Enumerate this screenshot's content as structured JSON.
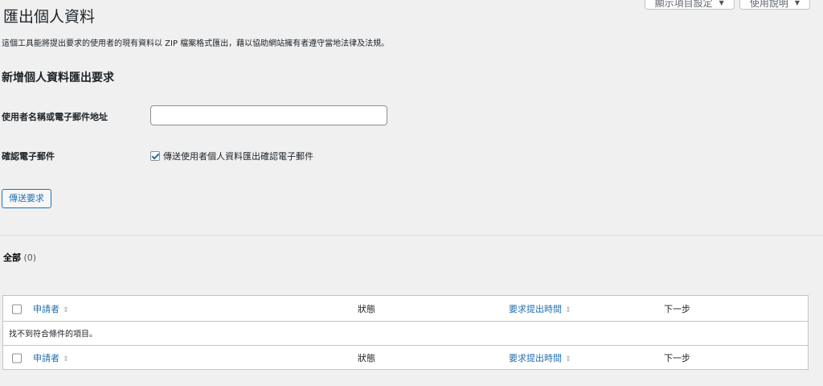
{
  "header": {
    "title": "匯出個人資料",
    "screen_options": "顯示項目設定",
    "help": "使用說明"
  },
  "intro_text": "這個工具能將提出要求的使用者的現有資料以 ZIP 檔案格式匯出，藉以協助網站擁有者遵守當地法律及法規。",
  "form": {
    "section_title": "新增個人資料匯出要求",
    "username_label": "使用者名稱或電子郵件地址",
    "username_value": "",
    "confirm_label": "確認電子郵件",
    "confirm_checkbox_label": "傳送使用者個人資料匯出確認電子郵件",
    "confirm_checked": true,
    "submit_label": "傳送要求"
  },
  "filters": {
    "all_label": "全部",
    "all_count": "(0)"
  },
  "table": {
    "columns": {
      "requester": "申請者",
      "status": "狀態",
      "requested": "要求提出時間",
      "next_steps": "下一步"
    },
    "empty_message": "找不到符合條件的項目。"
  },
  "icons": {
    "dropdown": "triangle-down-icon",
    "sort": "sort-arrows-icon",
    "check": "checkmark-icon"
  },
  "colors": {
    "link": "#2271b1",
    "background": "#f0f0f1",
    "panel": "#ffffff",
    "border": "#c3c4c7"
  }
}
